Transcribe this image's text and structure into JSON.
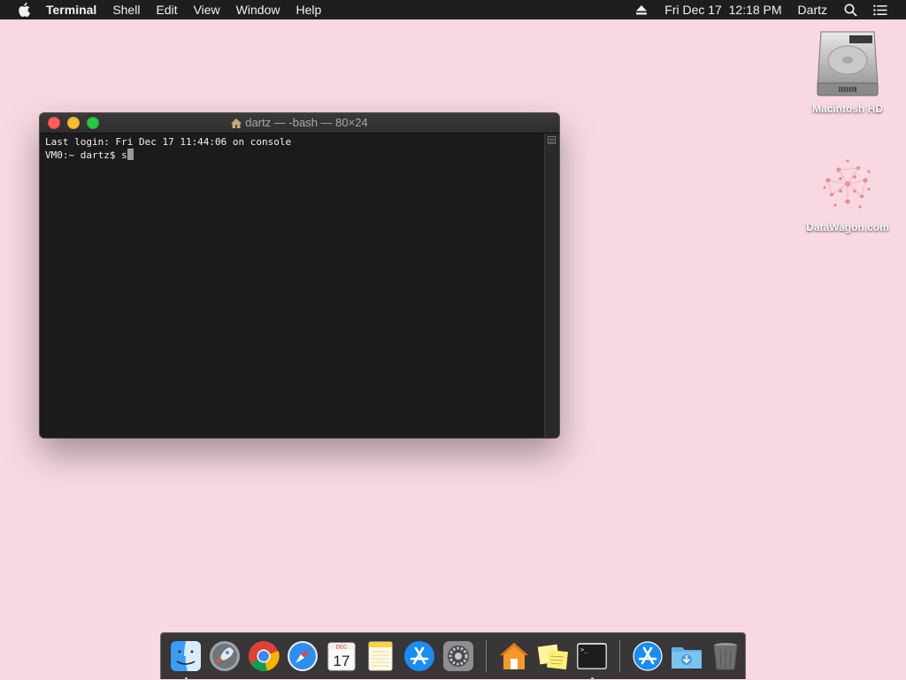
{
  "menubar": {
    "apple_icon": "apple-logo-icon",
    "app_name": "Terminal",
    "menus": [
      "Shell",
      "Edit",
      "View",
      "Window",
      "Help"
    ],
    "status": {
      "eject_icon": "eject-icon",
      "datetime": "Fri Dec 17  12:18 PM",
      "user": "Dartz",
      "search_icon": "spotlight-search-icon",
      "list_icon": "notification-center-icon"
    }
  },
  "desktop": {
    "background": "#f8d8e1",
    "icons": [
      {
        "label": "Macintosh HD",
        "icon": "hard-drive-icon"
      },
      {
        "label": "DataWagon.com",
        "icon": "datawagon-icon"
      }
    ]
  },
  "terminal": {
    "title": "dartz — -bash — 80×24",
    "lines": [
      "Last login: Fri Dec 17 11:44:06 on console",
      "VM0:~ dartz$ s"
    ]
  },
  "dock": {
    "apps": [
      {
        "name": "Finder",
        "icon": "finder-icon",
        "running": true
      },
      {
        "name": "Launchpad",
        "icon": "launchpad-icon",
        "running": false
      },
      {
        "name": "Chrome",
        "icon": "chrome-icon",
        "running": false
      },
      {
        "name": "Safari",
        "icon": "safari-icon",
        "running": false
      },
      {
        "name": "Calendar",
        "icon": "calendar-icon",
        "running": false,
        "month": "DEC",
        "day": "17"
      },
      {
        "name": "Notes",
        "icon": "notes-icon",
        "running": false
      },
      {
        "name": "App Store",
        "icon": "app-store-icon",
        "running": false
      },
      {
        "name": "System Preferences",
        "icon": "system-preferences-icon",
        "running": false
      },
      {
        "name": "Home",
        "icon": "home-icon",
        "running": false
      },
      {
        "name": "Stickies",
        "icon": "stickies-icon",
        "running": false
      },
      {
        "name": "Terminal",
        "icon": "terminal-icon",
        "running": true,
        "prompt": ">_"
      },
      {
        "name": "App Store Downloads",
        "icon": "app-store-downloads-icon",
        "running": false
      },
      {
        "name": "Downloads",
        "icon": "downloads-folder-icon",
        "running": false
      },
      {
        "name": "Trash",
        "icon": "trash-icon",
        "running": false
      }
    ]
  }
}
